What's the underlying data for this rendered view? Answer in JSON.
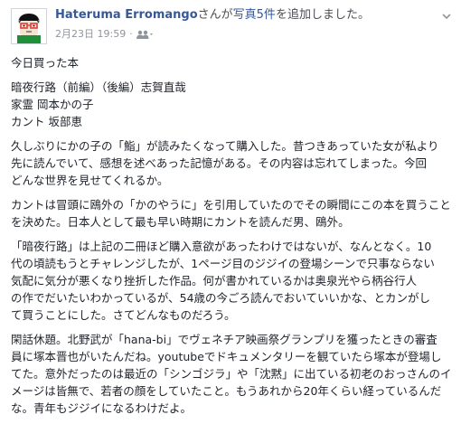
{
  "post": {
    "author": "Hateruma Erromango",
    "action_prefix": "さんが",
    "action_link": "写真5件",
    "action_suffix": "を追加しました。",
    "timestamp": "2月23日 19:59",
    "privacy_icon": "friends-icon",
    "menu_icon": "chevron-down-icon"
  },
  "content": {
    "heading": "今日買った本",
    "books": [
      "暗夜行路（前編）（後編）志賀直哉",
      "家霊 岡本かの子",
      "カント 坂部恵"
    ],
    "paragraph1": [
      "久しぶりにかの子の「鮨」が読みたくなって購入した。昔つきあっていた女が私より",
      "先に読んでいて、感想を述べあった記憶がある。その内容は忘れてしまった。今回",
      "どんな世界を見せてくれるか。"
    ],
    "paragraph2": [
      "カントは冒頭に鴎外の「かのやうに」を引用していたのでその瞬間にこの本を買うこと",
      "を決めた。日本人として最も早い時期にカントを読んだ男、鴎外。"
    ],
    "paragraph3": [
      "「暗夜行路」は上記の二冊ほど購入意欲があったわけではないが、なんとなく。10",
      "代の頃読もうとチャレンジしたが、1ページ目のジジイの登場シーンで只事ならない",
      "気配に気分が悪くなり挫折した作品。何が書かれているかは奥泉光やら柄谷行人",
      "の作でだいたいわかっているが、54歳の今ごろ読んでおいていいかな、とカンがし",
      "て買うことにした。さてどんなものだろう。"
    ],
    "paragraph4": [
      "閑話休題。北野武が「hana-bi」でヴェネチア映画祭グランプリを獲ったときの審査",
      "員に塚本晋也がいたんだね。youtubeでドキュメンタリーを観ていたら塚本が登場し",
      "てた。意外だったのは最近の「シンゴジラ」や「沈黙」に出ている初老のおっさんのイ",
      "メージは皆無で、若者の顔をしていたこと。もうあれから20年くらい経っているんだ",
      "な。青年もジジイになるわけだよ。"
    ]
  }
}
